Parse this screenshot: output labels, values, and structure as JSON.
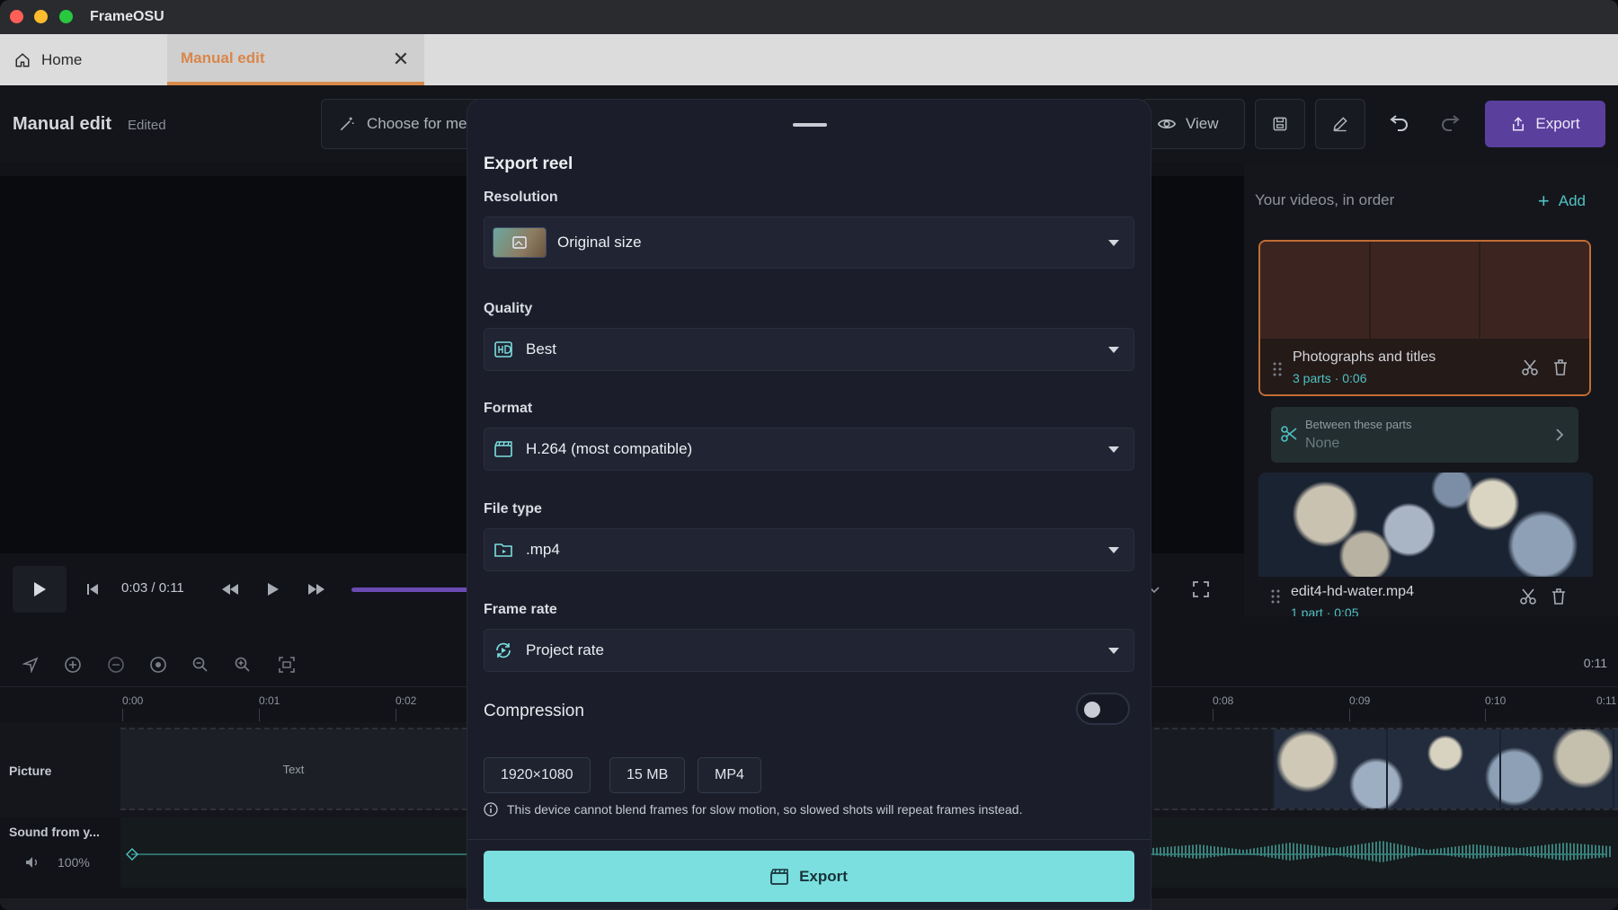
{
  "app": {
    "title": "FrameOSU"
  },
  "tabs": {
    "home": "Home",
    "manual": "Manual edit"
  },
  "toolbar": {
    "title": "Manual edit",
    "status": "Edited",
    "choose_label": "Choose for me",
    "view_label": "View",
    "export_label": "Export"
  },
  "player": {
    "timecode": "0:03 / 0:11"
  },
  "videos_panel": {
    "title": "Your videos, in order",
    "add_label": "Add",
    "items": [
      {
        "name": "Photographs and titles",
        "meta": "3 parts · 0:06"
      },
      {
        "name": "edit4-hd-water.mp4",
        "meta": "1 part · 0:05"
      }
    ],
    "transition": {
      "label": "Between these parts",
      "value": "None"
    }
  },
  "timeline": {
    "end_time": "0:11",
    "ticks": [
      "0:00",
      "0:01",
      "0:02",
      "0:08",
      "0:09",
      "0:10",
      "0:11"
    ],
    "tracks": {
      "picture": "Picture",
      "text_clip": "Text",
      "sound": "Sound from y...",
      "volume": "100%"
    }
  },
  "modal": {
    "title": "Export reel",
    "resolution": {
      "label": "Resolution",
      "value": "Original size"
    },
    "quality": {
      "label": "Quality",
      "value": "Best"
    },
    "format": {
      "label": "Format",
      "value": "H.264 (most compatible)"
    },
    "file_type": {
      "label": "File type",
      "value": ".mp4"
    },
    "frame_rate": {
      "label": "Frame rate",
      "value": "Project rate"
    },
    "compression": {
      "label": "Compression",
      "enabled": false
    },
    "summary": {
      "size": "1920×1080",
      "filesize": "15 MB",
      "container": "MP4"
    },
    "note": "This device cannot blend frames for slow motion, so slowed shots will repeat frames instead.",
    "export_label": "Export"
  },
  "colors": {
    "accent": "#7bdfdf",
    "export_button": "#5b3f9c",
    "tab_active": "#d9864a",
    "teal_text": "#4fc2c2"
  }
}
